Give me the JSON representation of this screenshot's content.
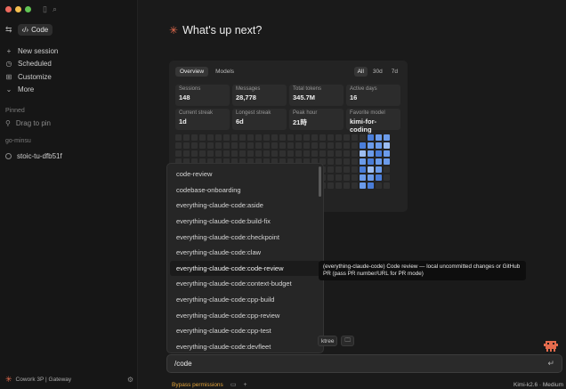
{
  "sidebar": {
    "code_label": "Code",
    "nav": [
      {
        "icon": "plus-icon",
        "glyph": "+",
        "label": "New session"
      },
      {
        "icon": "clock-icon",
        "glyph": "◷",
        "label": "Scheduled"
      },
      {
        "icon": "customize-icon",
        "glyph": "⊞",
        "label": "Customize"
      },
      {
        "icon": "chevron-down-icon",
        "glyph": "⌄",
        "label": "More"
      }
    ],
    "pinned_label": "Pinned",
    "drag_to_pin": "Drag to pin",
    "group_label": "go-minsu",
    "session": "stoic-tu-dfb51f",
    "footer": "Cowork 3P | Gateway"
  },
  "main": {
    "heading": "What's up next?",
    "tabs": [
      "Overview",
      "Models"
    ],
    "ranges": [
      "All",
      "30d",
      "7d"
    ],
    "stats": [
      {
        "label": "Sessions",
        "value": "148"
      },
      {
        "label": "Messages",
        "value": "28,778"
      },
      {
        "label": "Total tokens",
        "value": "345.7M"
      },
      {
        "label": "Active days",
        "value": "16"
      },
      {
        "label": "Current streak",
        "value": "1d"
      },
      {
        "label": "Longest streak",
        "value": "6d"
      },
      {
        "label": "Peak hour",
        "value": "21時"
      },
      {
        "label": "Favorite model",
        "value": "kimi-for-coding"
      }
    ]
  },
  "dropdown": {
    "items": [
      "code-review",
      "codebase-onboarding",
      "everything-claude-code:aside",
      "everything-claude-code:build-fix",
      "everything-claude-code:checkpoint",
      "everything-claude-code:claw",
      "everything-claude-code:code-review",
      "everything-claude-code:context-budget",
      "everything-claude-code:cpp-build",
      "everything-claude-code:cpp-review",
      "everything-claude-code:cpp-test",
      "everything-claude-code:devfleet"
    ],
    "selected_index": 6,
    "tooltip": "(everything-claude-code) Code review — local uncommitted changes or GitHub PR (pass PR number/URL for PR mode)"
  },
  "chips": {
    "worktree": "ktree",
    "folder_icon": "folder-icon"
  },
  "input": {
    "value": "/code"
  },
  "bottom": {
    "bypass": "Bypass permissions",
    "model": "Kimi-k2.6 · Medium"
  },
  "colors": {
    "accent": "#e46b4d",
    "heat_active": "#6b9bea",
    "bypass": "#e0a23a"
  }
}
